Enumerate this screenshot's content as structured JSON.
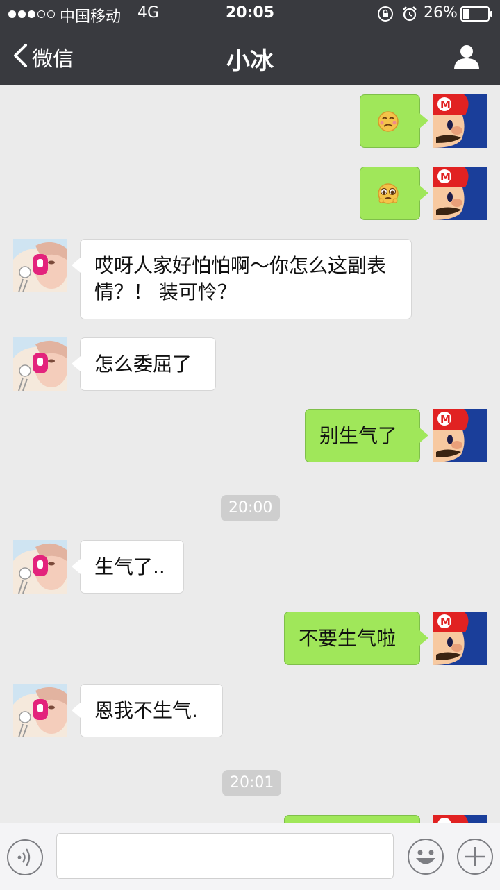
{
  "status_bar": {
    "carrier": "中国移动",
    "network": "4G",
    "time": "20:05",
    "battery": "26%",
    "signal_bars_filled": 3,
    "signal_bars_total": 5
  },
  "nav": {
    "back_label": "微信",
    "title": "小冰"
  },
  "messages": [
    {
      "from": "me",
      "type": "emoji",
      "emoji": "sad-face-emoji"
    },
    {
      "from": "me",
      "type": "emoji",
      "emoji": "pleading-face-emoji"
    },
    {
      "from": "bot",
      "type": "text",
      "text": "哎呀人家好怕怕啊～你怎么这副表情？！ 装可怜？"
    },
    {
      "from": "bot",
      "type": "text",
      "text": "怎么委屈了"
    },
    {
      "from": "me",
      "type": "text",
      "text": "别生气了"
    },
    {
      "type": "time",
      "text": "20:00"
    },
    {
      "from": "bot",
      "type": "text",
      "text": "生气了.."
    },
    {
      "from": "me",
      "type": "text",
      "text": "不要生气啦"
    },
    {
      "from": "bot",
      "type": "text",
      "text": "恩我不生气."
    },
    {
      "type": "time",
      "text": "20:01"
    },
    {
      "from": "me",
      "type": "text",
      "text": ""
    }
  ],
  "input": {
    "value": "",
    "placeholder": ""
  },
  "icons": {
    "voice": "voice-icon",
    "emoji": "smiley-icon",
    "more": "plus-icon"
  },
  "colors": {
    "nav_bg": "#393a3f",
    "chat_bg": "#ebebeb",
    "out_bubble": "#a0e75a",
    "in_bubble": "#ffffff",
    "time_pill": "#cecece"
  }
}
